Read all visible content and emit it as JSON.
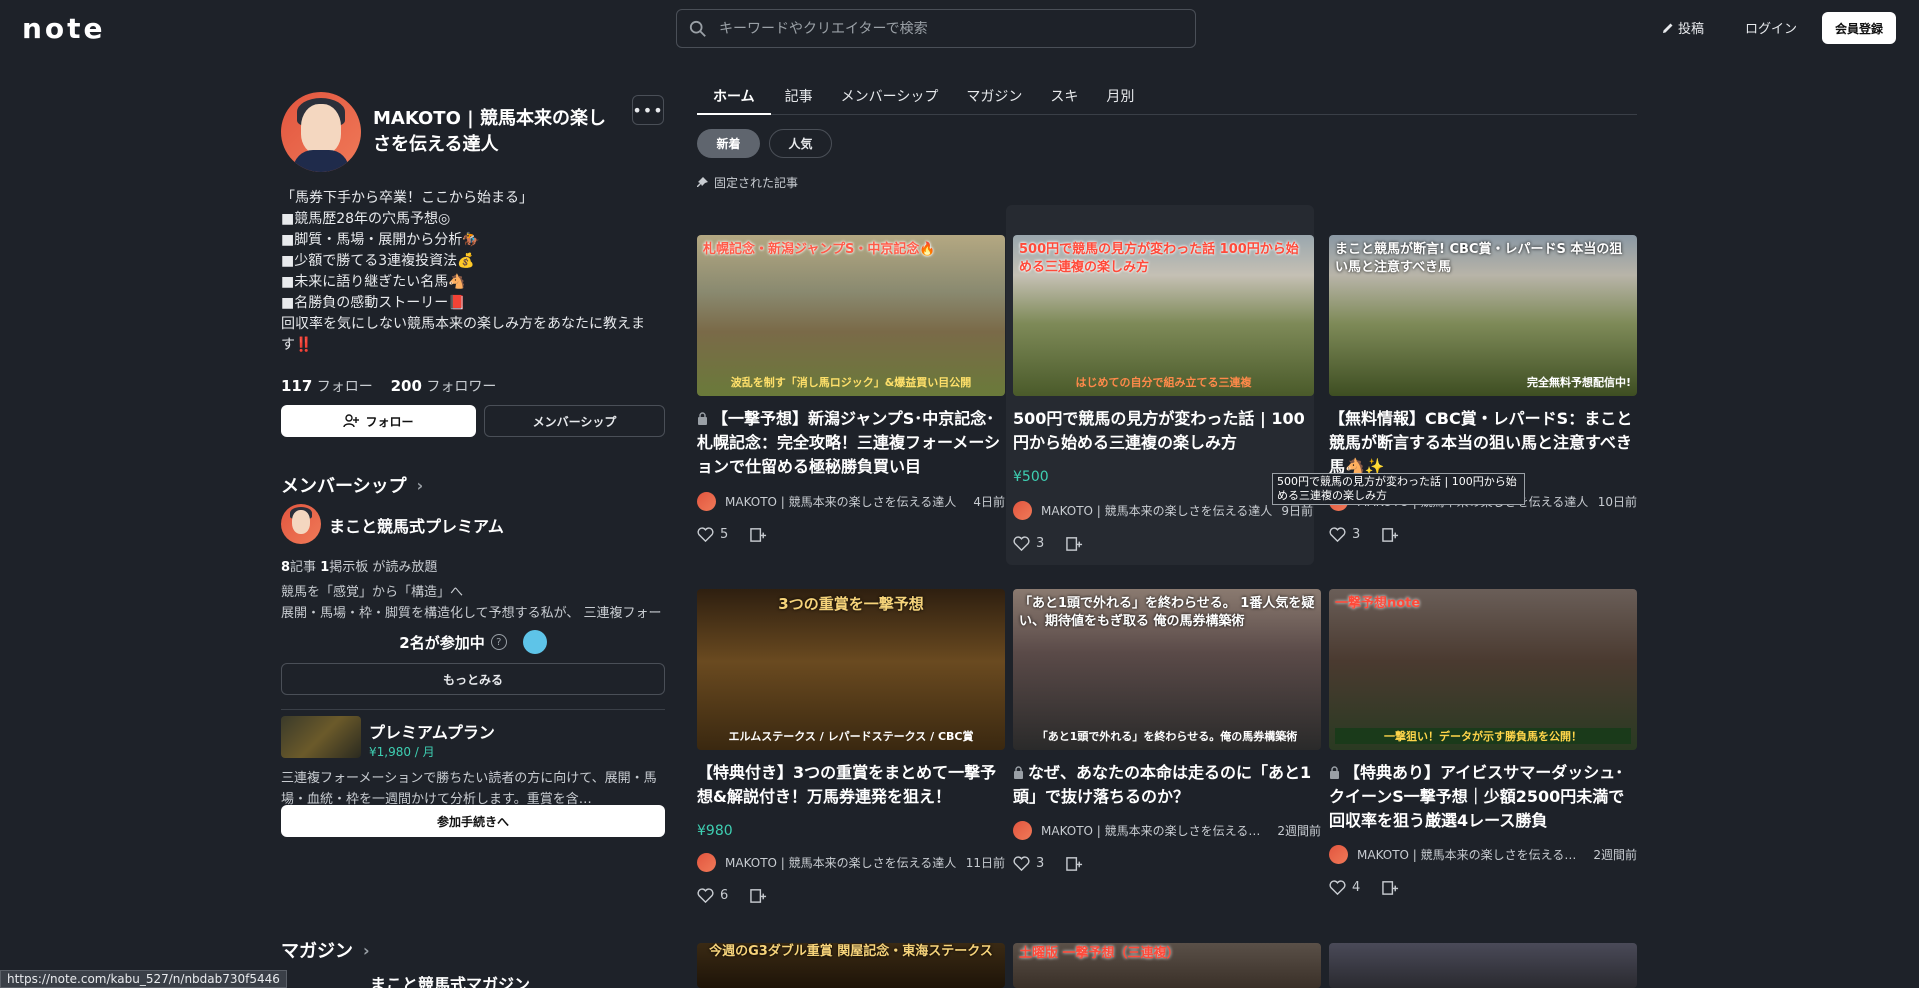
{
  "header": {
    "logo": "note",
    "search_placeholder": "キーワードやクリエイターで検索",
    "post_label": "投稿",
    "login_label": "ログイン",
    "signup_label": "会員登録"
  },
  "profile": {
    "name": "MAKOTO | 競馬本来の楽しさを伝える達人",
    "bio": [
      "「馬券下手から卒業！ここから始まる」",
      "■競馬歴28年の穴馬予想◎",
      "■脚質・馬場・展開から分析🏇",
      "■少額で勝てる3連複投資法💰",
      "■未来に語り継ぎたい名馬🐴",
      "■名勝負の感動ストーリー📕",
      "回収率を気にしない競馬本来の楽しみ方をあなたに教えます‼️"
    ],
    "follow_count": "117",
    "follow_label": "フォロー",
    "follower_count": "200",
    "follower_label": "フォロワー",
    "follow_button": "フォロー",
    "membership_button": "メンバーシップ"
  },
  "membership": {
    "section_title": "メンバーシップ",
    "name": "まこと競馬式プレミアム",
    "articles_count": "8",
    "articles_label": "記事",
    "boards_count": "1",
    "boards_label": "掲示板 が読み放題",
    "description": "競馬を「感覚」から「構造」へ\n展開・馬場・枠・脚質を構造化して予想する私が、 三連複フォーメーションで勝つための実戦的なコンテンツをお届け…",
    "participants": "2名が参加中",
    "more_button": "もっとみる",
    "plan_name": "プレミアムプラン",
    "plan_price": "¥1,980 / 月",
    "plan_description": "三連複フォーメーションで勝ちたい読者の方に向けて、展開・馬場・血統・枠を一週間かけて分析します。重賞を含…",
    "join_button": "参加手続きへ"
  },
  "magazine": {
    "section_title": "マガジン",
    "name": "まこと競馬式マガジン"
  },
  "tabs": [
    "ホーム",
    "記事",
    "メンバーシップ",
    "マガジン",
    "スキ",
    "月別"
  ],
  "filters": {
    "new": "新着",
    "popular": "人気"
  },
  "pinned_label": "固定された記事",
  "articles": [
    {
      "thumb_caption": "札幌記念・新潟ジャンプS・中京記念🔥",
      "thumb_caption2": "波乱を制す「消し馬ロジック」&爆益買い目公開",
      "title": "【一撃予想】新潟ジャンプS･中京記念･札幌記念：完全攻略！三連複フォーメーションで仕留める極秘勝負買い目",
      "locked": true,
      "price": "",
      "author": "MAKOTO | 競馬本来の楽しさを伝える達人",
      "time": "4日前",
      "likes": "5"
    },
    {
      "thumb_caption": "500円で競馬の見方が変わった話 100円から始める三連複の楽しみ方",
      "thumb_caption2": "はじめての自分で組み立てる三連複",
      "title": "500円で競馬の見方が変わった話 | 100円から始める三連複の楽しみ方",
      "locked": false,
      "price": "¥500",
      "author": "MAKOTO | 競馬本来の楽しさを伝える達人",
      "time": "9日前",
      "likes": "3"
    },
    {
      "thumb_caption": "まこと競馬が断言! CBC賞・レパードS 本当の狙い馬と注意すべき馬",
      "thumb_caption2": "完全無料予想配信中!",
      "title": "【無料情報】CBC賞・レパードS：まこと競馬が断言する本当の狙い馬と注意すべき馬🐴✨",
      "locked": false,
      "price": "",
      "author": "MAKOTO | 競馬本来の楽しさを伝える達人",
      "time": "10日前",
      "likes": "3"
    },
    {
      "thumb_caption": "3つの重賞を一撃予想",
      "thumb_caption2": "エルムステークス / レパードステークス / CBC賞",
      "title": "【特典付き】3つの重賞をまとめて一撃予想&解説付き！万馬券連発を狙え！",
      "locked": false,
      "price": "¥980",
      "author": "MAKOTO | 競馬本来の楽しさを伝える達人",
      "time": "11日前",
      "likes": "6"
    },
    {
      "thumb_caption": "「あと1頭で外れる」を終わらせる。 1番人気を疑い、期待値をもぎ取る 俺の馬券構築術",
      "thumb_caption2": "「あと1頭で外れる」を終わらせる。俺の馬券構築術",
      "title": "なぜ、あなたの本命は走るのに「あと1頭」で抜け落ちるのか？",
      "locked": true,
      "price": "",
      "author": "MAKOTO | 競馬本来の楽しさを伝える達人",
      "time": "2週間前",
      "likes": "3"
    },
    {
      "thumb_caption": "一撃予想note",
      "thumb_caption2": "一撃狙い！データが示す勝負馬を公開！",
      "title": "【特典あり】アイビスサマーダッシュ･クイーンS一撃予想｜少額2500円未満で回収率を狙う厳選4レース勝負",
      "locked": true,
      "price": "",
      "author": "MAKOTO | 競馬本来の楽しさを伝える達人",
      "time": "2週間前",
      "likes": "4"
    },
    {
      "thumb_caption": "今週のG3ダブル重賞 関屋記念・東海ステークス",
      "thumb_caption2": "",
      "title": "",
      "locked": false,
      "price": "",
      "author": "",
      "time": "",
      "likes": ""
    },
    {
      "thumb_caption": "土曜版 一撃予想（三連複）",
      "thumb_caption2": "",
      "title": "",
      "locked": false,
      "price": "",
      "author": "",
      "time": "",
      "likes": ""
    }
  ],
  "tooltip": "500円で競馬の見方が変わった話 | 100円から始める三連複の楽しみ方",
  "status_url": "https://note.com/kabu_527/n/nbdab730f5446",
  "colors": {
    "background": "#1e2229",
    "accent": "#3ecfb2",
    "text": "#e8eaed"
  }
}
